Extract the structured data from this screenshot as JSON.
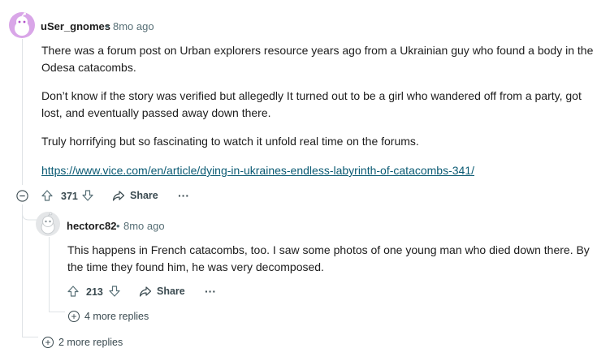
{
  "comment1": {
    "username": "uSer_gnomes",
    "time": "8mo ago",
    "paragraphs": [
      "There was a forum post on Urban explorers resource years ago from a Ukrainian guy who found a body in the Odesa catacombs.",
      "Don’t know if the story was verified but allegedly It turned out to be a girl who wandered off from a party, got lost, and eventually passed away down there.",
      "Truly horrifying but so fascinating to watch it unfold real time on the forums."
    ],
    "link": "https://www.vice.com/en/article/dying-in-ukraines-endless-labyrinth-of-catacombs-341/",
    "votes": "371",
    "share_label": "Share",
    "more_replies": "2 more replies"
  },
  "comment2": {
    "username": "hectorc82",
    "time": "8mo ago",
    "text": "This happens in French catacombs, too. I saw some photos of one young man who died down there. By the time they found him, he was very decomposed.",
    "votes": "213",
    "share_label": "Share",
    "more_replies": "4 more replies"
  },
  "separator": "•",
  "overflow": "···",
  "colors": {
    "avatar1_bg": "#d9a6e8",
    "link": "#0a5a73",
    "meta": "#576f76",
    "thread": "#dfe3e6"
  },
  "icons": [
    "upvote-icon",
    "downvote-icon",
    "share-icon",
    "overflow-icon",
    "collapse-icon",
    "expand-icon"
  ]
}
